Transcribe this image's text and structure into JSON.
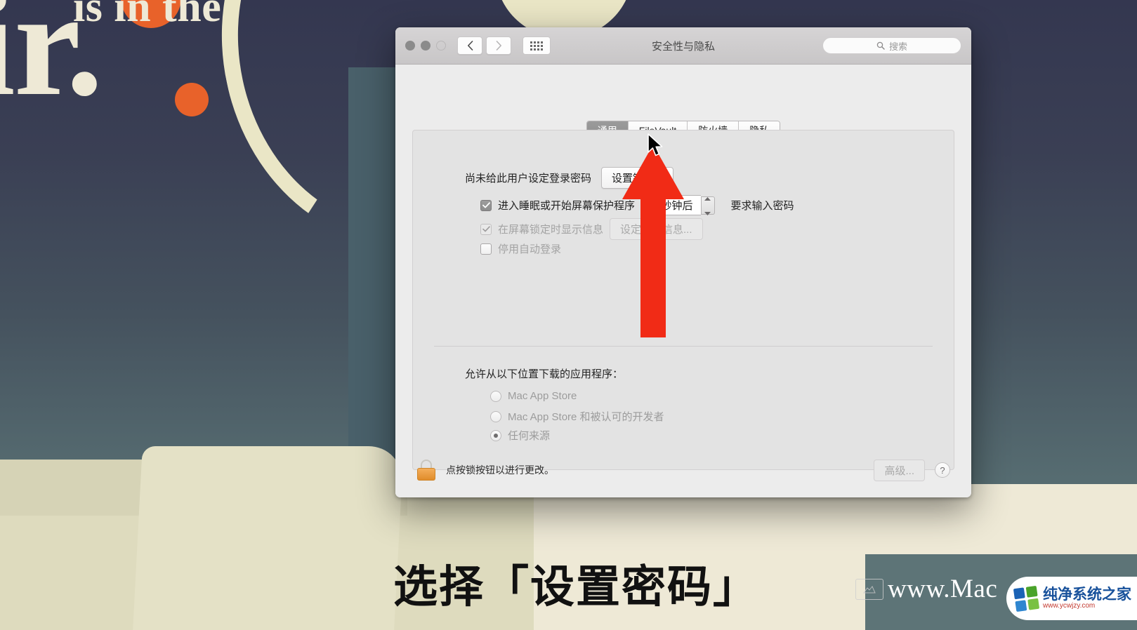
{
  "wallpaper": {
    "headline_line1": "is in the",
    "headline_line2": "ir.",
    "bg_top_color": "#343750",
    "bg_bottom_color": "#63797c",
    "accent_dot_color": "#e8622a",
    "cream_color": "#eee9d6"
  },
  "window": {
    "title": "安全性与隐私",
    "back_icon": "chevron-left-icon",
    "forward_icon": "chevron-right-icon",
    "grid_icon": "show-all-grid-icon",
    "search": {
      "icon": "search-icon",
      "placeholder": "搜索",
      "value": ""
    },
    "traffic_lights": [
      "close",
      "minimize",
      "zoom"
    ]
  },
  "tabs": [
    {
      "label": "通用",
      "active": true
    },
    {
      "label": "FileVault",
      "active": false
    },
    {
      "label": "防火墙",
      "active": false
    },
    {
      "label": "隐私",
      "active": false
    }
  ],
  "general": {
    "password_status_label": "尚未给此用户设定登录密码",
    "set_password_button": "设置锁码...",
    "require_password": {
      "checked": true,
      "enabled": true,
      "label": "进入睡眠或开始屏幕保护程序",
      "delay_value": "5 秒钟后",
      "trailing_label": "要求输入密码"
    },
    "show_message": {
      "checked": true,
      "enabled": false,
      "label": "在屏幕锁定时显示信息",
      "button": "设定锁定信息..."
    },
    "disable_autologin": {
      "checked": false,
      "enabled": false,
      "label": "停用自动登录"
    },
    "download_section_title": "允许从以下位置下载的应用程序：",
    "download_options": [
      {
        "label": "Mac App Store",
        "selected": false
      },
      {
        "label": "Mac App Store 和被认可的开发者",
        "selected": false
      },
      {
        "label": "任何来源",
        "selected": true
      }
    ]
  },
  "footer": {
    "lock_icon": "lock-open-icon",
    "lock_text": "点按锁按钮以进行更改。",
    "advanced_button": "高级...",
    "help_button": "?"
  },
  "annotations": {
    "arrow_color": "#f12b16",
    "arrow_name": "red-up-arrow",
    "cursor_name": "mouse-pointer",
    "caption": "选择「设置密码」"
  },
  "watermark": {
    "url_text": "www.Mac",
    "badge_title": "纯净系统之家",
    "badge_url": "www.ycwjzy.com",
    "badge_colors": [
      "#1a62b5",
      "#4aa32a",
      "#2f86d0",
      "#7ac143"
    ]
  }
}
